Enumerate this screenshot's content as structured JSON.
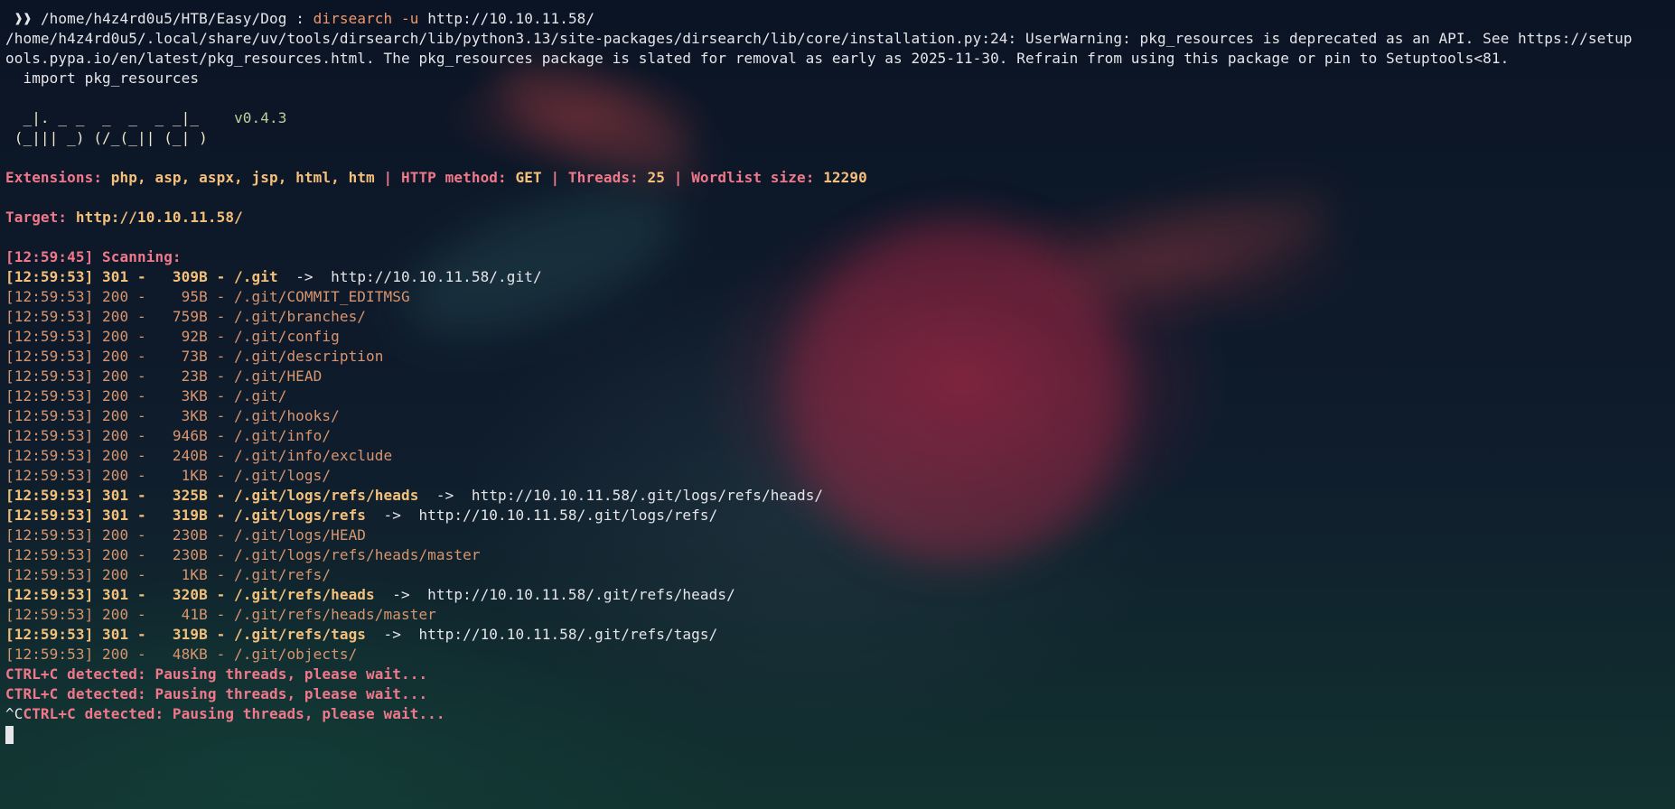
{
  "prompt": {
    "marker": " ❱❱ ",
    "path": "/home/h4z4rd0u5/HTB/Easy/Dog",
    "sep": " : ",
    "command": "dirsearch",
    "flag": " -u ",
    "url": "http://10.10.11.58/"
  },
  "warning_lines": [
    "/home/h4z4rd0u5/.local/share/uv/tools/dirsearch/lib/python3.13/site-packages/dirsearch/lib/core/installation.py:24: UserWarning: pkg_resources is deprecated as an API. See https://setup",
    "ools.pypa.io/en/latest/pkg_resources.html. The pkg_resources package is slated for removal as early as 2025-11-30. Refrain from using this package or pin to Setuptools<81.",
    "  import pkg_resources"
  ],
  "banner": {
    "line1": "  _|. _ _  _  _  _ _|_    ",
    "version": "v0.4.3",
    "line2": " (_||| _) (/_(_|| (_| )"
  },
  "config": {
    "ext_label": "Extensions: ",
    "ext_value": "php, asp, aspx, jsp, html, htm",
    "sep": " | ",
    "method_label": "HTTP method: ",
    "method_value": "GET",
    "threads_label": "Threads: ",
    "threads_value": "25",
    "wordlist_label": "Wordlist size: ",
    "wordlist_value": "12290"
  },
  "target": {
    "label": "Target: ",
    "url": "http://10.10.11.58/"
  },
  "scanning": "[12:59:45] Scanning:",
  "results": [
    {
      "text": "[12:59:53] 301 -   309B - /.git  ",
      "redirect": true,
      "arrow": "->",
      "target": "  http://10.10.11.58/.git/"
    },
    {
      "text": "[12:59:53] 200 -    95B - /.git/COMMIT_EDITMSG",
      "redirect": false
    },
    {
      "text": "[12:59:53] 200 -   759B - /.git/branches/",
      "redirect": false
    },
    {
      "text": "[12:59:53] 200 -    92B - /.git/config",
      "redirect": false
    },
    {
      "text": "[12:59:53] 200 -    73B - /.git/description",
      "redirect": false
    },
    {
      "text": "[12:59:53] 200 -    23B - /.git/HEAD",
      "redirect": false
    },
    {
      "text": "[12:59:53] 200 -    3KB - /.git/",
      "redirect": false
    },
    {
      "text": "[12:59:53] 200 -    3KB - /.git/hooks/",
      "redirect": false
    },
    {
      "text": "[12:59:53] 200 -   946B - /.git/info/",
      "redirect": false
    },
    {
      "text": "[12:59:53] 200 -   240B - /.git/info/exclude",
      "redirect": false
    },
    {
      "text": "[12:59:53] 200 -    1KB - /.git/logs/",
      "redirect": false
    },
    {
      "text": "[12:59:53] 301 -   325B - /.git/logs/refs/heads  ",
      "redirect": true,
      "arrow": "->",
      "target": "  http://10.10.11.58/.git/logs/refs/heads/"
    },
    {
      "text": "[12:59:53] 301 -   319B - /.git/logs/refs  ",
      "redirect": true,
      "arrow": "->",
      "target": "  http://10.10.11.58/.git/logs/refs/"
    },
    {
      "text": "[12:59:53] 200 -   230B - /.git/logs/HEAD",
      "redirect": false
    },
    {
      "text": "[12:59:53] 200 -   230B - /.git/logs/refs/heads/master",
      "redirect": false
    },
    {
      "text": "[12:59:53] 200 -    1KB - /.git/refs/",
      "redirect": false
    },
    {
      "text": "[12:59:53] 301 -   320B - /.git/refs/heads  ",
      "redirect": true,
      "arrow": "->",
      "target": "  http://10.10.11.58/.git/refs/heads/"
    },
    {
      "text": "[12:59:53] 200 -    41B - /.git/refs/heads/master",
      "redirect": false
    },
    {
      "text": "[12:59:53] 301 -   319B - /.git/refs/tags  ",
      "redirect": true,
      "arrow": "->",
      "target": "  http://10.10.11.58/.git/refs/tags/"
    },
    {
      "text": "[12:59:53] 200 -   48KB - /.git/objects/",
      "redirect": false
    }
  ],
  "ctrlc": [
    {
      "prefix": "",
      "text": "CTRL+C detected: Pausing threads, please wait..."
    },
    {
      "prefix": "",
      "text": "CTRL+C detected: Pausing threads, please wait..."
    },
    {
      "prefix": "^C",
      "text": "CTRL+C detected: Pausing threads, please wait..."
    }
  ],
  "colors": {
    "background": "#0c1a2a",
    "foreground": "#e6e6ea",
    "pink": "#f0788a",
    "yellow": "#f5c07a",
    "orange": "#d9956e"
  }
}
